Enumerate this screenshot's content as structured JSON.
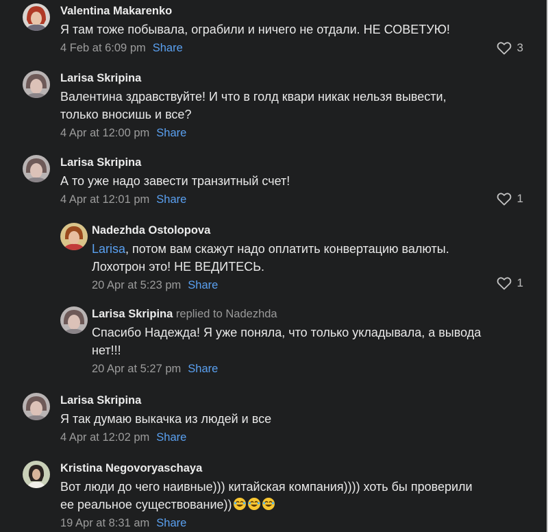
{
  "comments": [
    {
      "author": "Valentina Makarenko",
      "line1": "Я там тоже побывала, ограбили и ничего не отдали. НЕ СОВЕТУЮ!",
      "timestamp": "4 Feb at 6:09 pm",
      "share": "Share",
      "likes": "3"
    },
    {
      "author": "Larisa Skripina",
      "line1": "Валентина здравствуйте! И что в голд квари никак нельзя вывести,",
      "line2": "только вносишь и все?",
      "timestamp": "4 Apr at 12:00 pm",
      "share": "Share"
    },
    {
      "author": "Larisa Skripina",
      "line1": "А то уже надо завести транзитный счет!",
      "timestamp": "4 Apr at 12:01 pm",
      "share": "Share",
      "likes": "1"
    },
    {
      "author": "Nadezhda Ostolopova",
      "mention": "Larisa",
      "line1": ", потом вам скажут надо оплатить конвертацию валюты.",
      "line2": "Лохотрон это! НЕ ВЕДИТЕСЬ.",
      "timestamp": "20 Apr at 5:23 pm",
      "share": "Share",
      "likes": "1"
    },
    {
      "author": "Larisa Skripina",
      "replied_to": "replied to Nadezhda",
      "line1": "Спасибо Надежда! Я уже поняла, что только укладывала, а вывода",
      "line2": "нет!!!",
      "timestamp": "20 Apr at 5:27 pm",
      "share": "Share"
    },
    {
      "author": "Larisa Skripina",
      "line1": "Я так думаю выкачка из людей и все",
      "timestamp": "4 Apr at 12:02 pm",
      "share": "Share"
    },
    {
      "author": "Kristina Negovoryaschaya",
      "line1": "Вот люди до чего наивные))) китайская компания)))) хоть бы проверили",
      "line2": "ее реальное существование))",
      "timestamp": "19 Apr at 8:31 am",
      "share": "Share"
    }
  ],
  "icons": {
    "like": "heart-outline-icon",
    "emoji": "rolling-on-floor-laughing-emoji"
  },
  "colors": {
    "background": "#1e1f20",
    "link": "#5aa0f0",
    "muted": "#9c9c9c"
  }
}
